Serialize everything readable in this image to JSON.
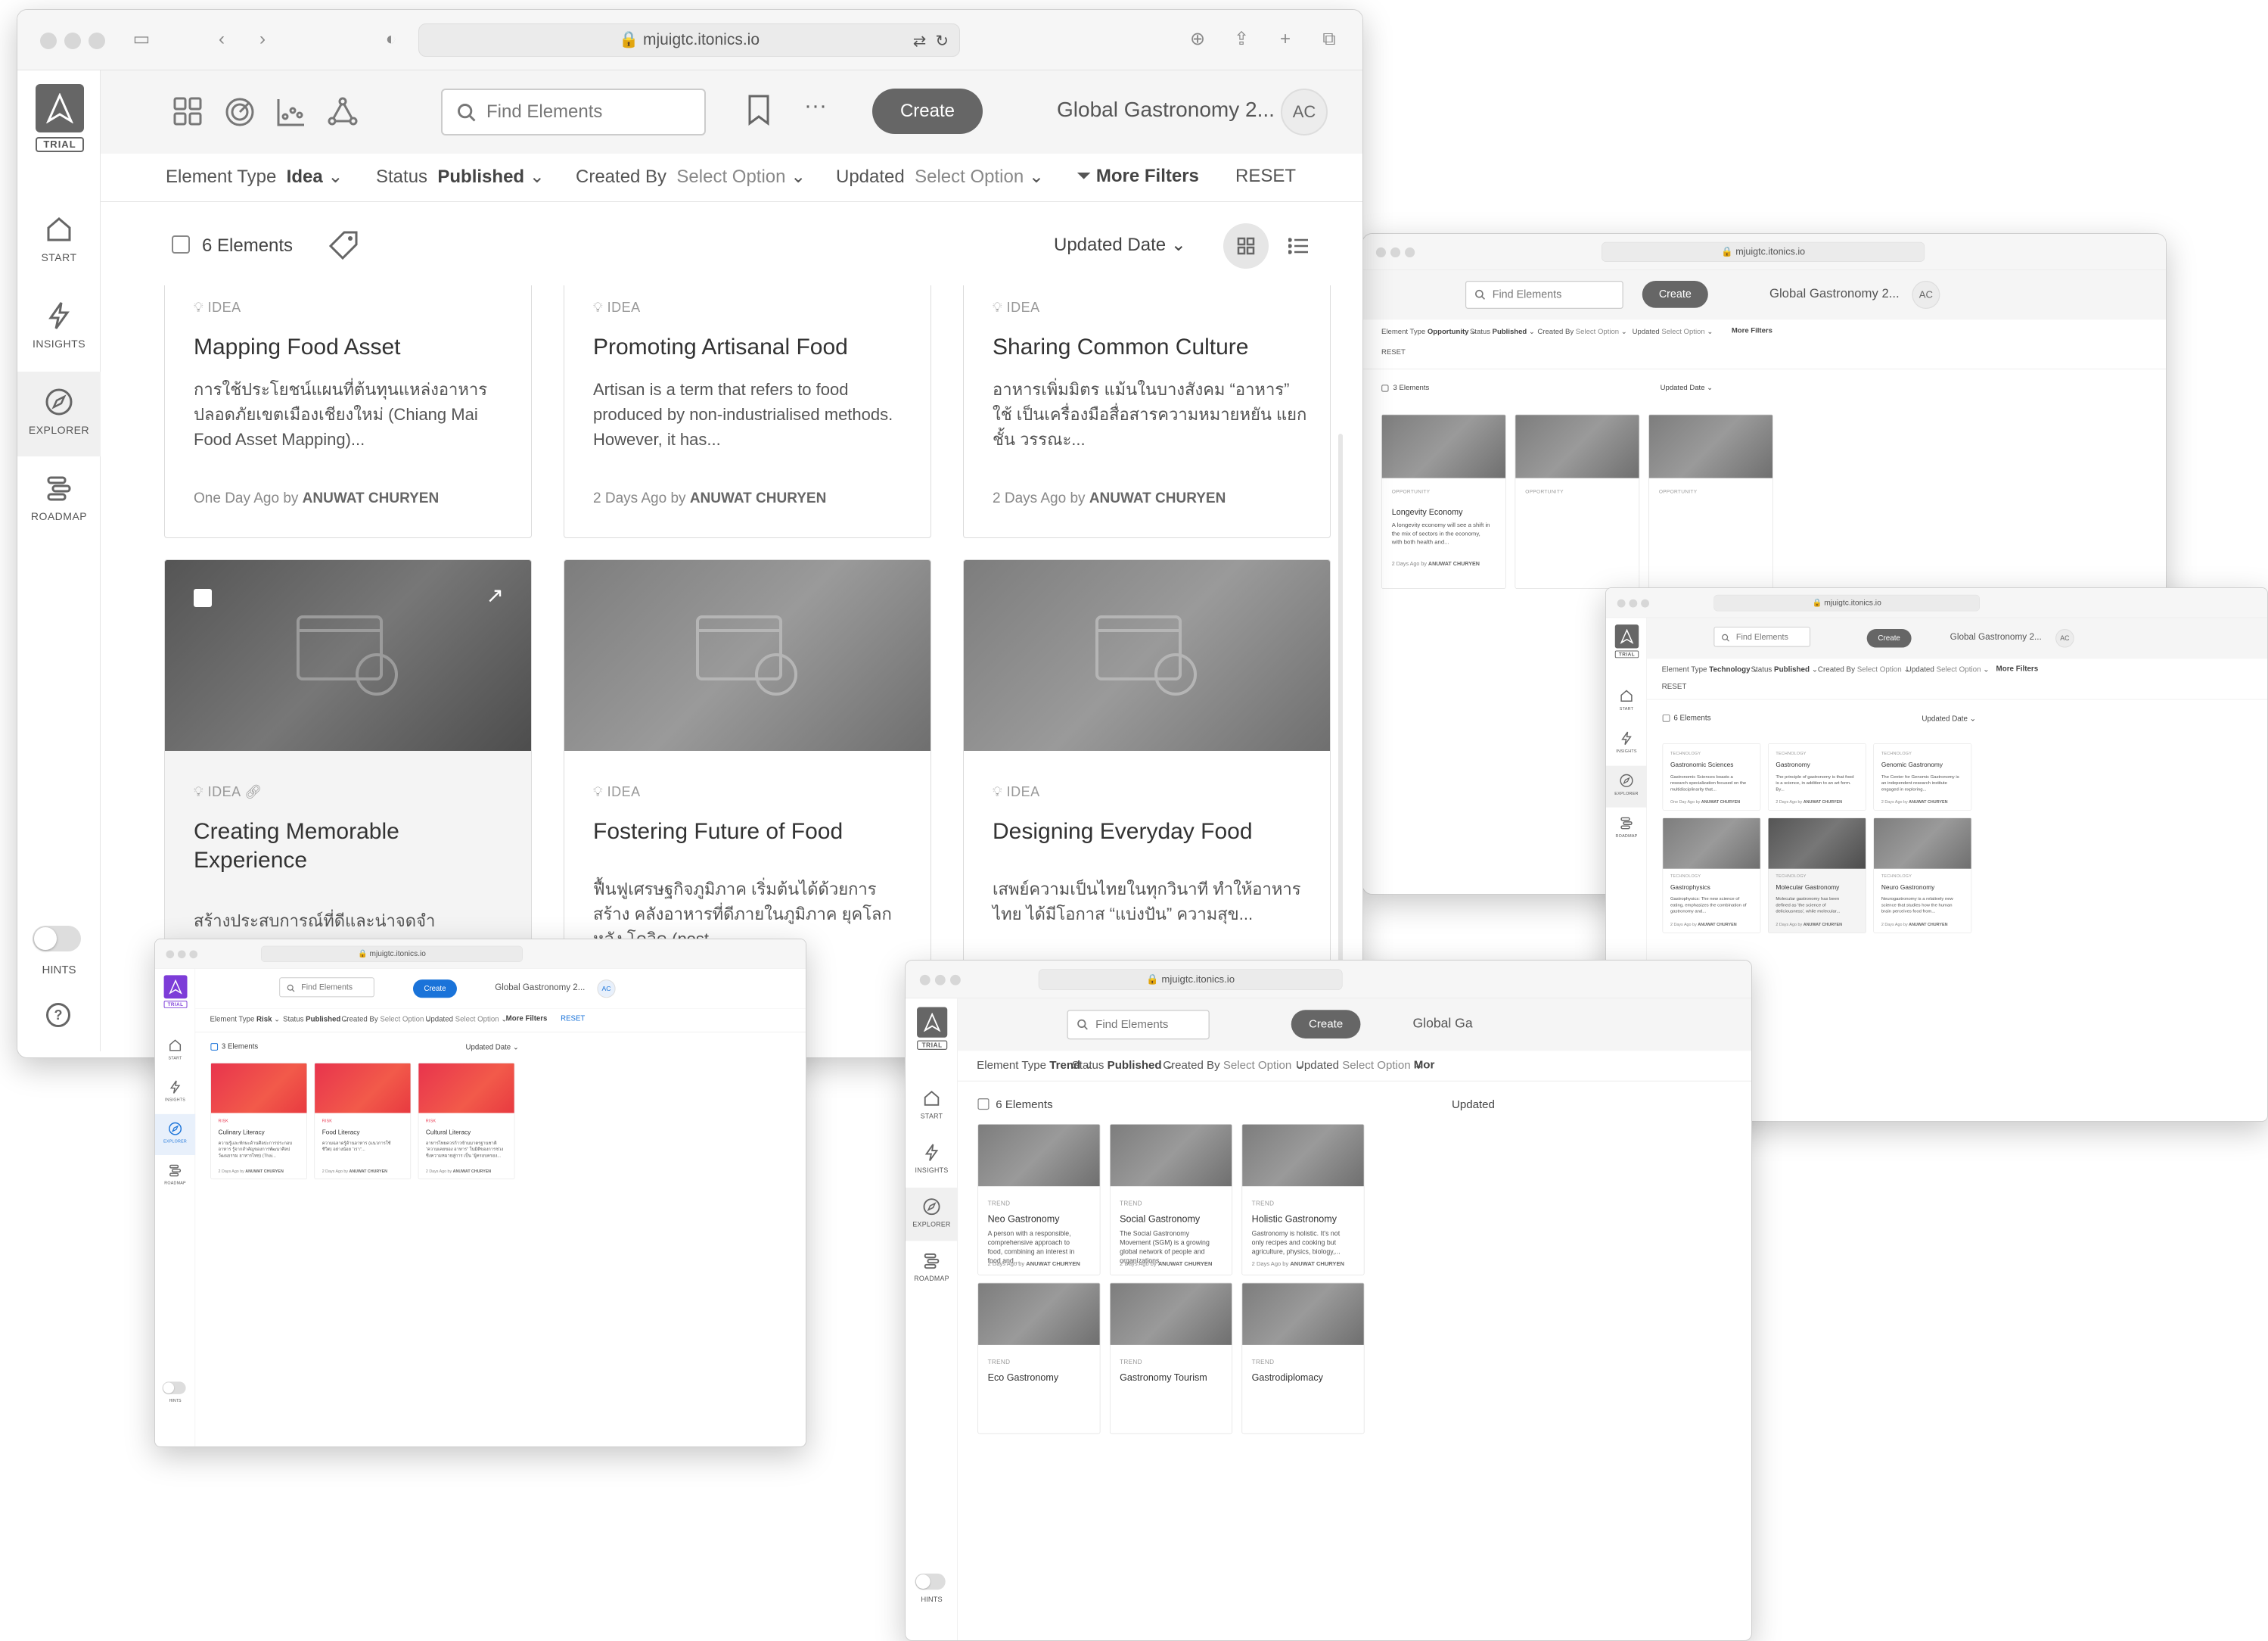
{
  "windows": {
    "main": {
      "url": "mjuigtc.itonics.io",
      "workspace": "Global Gastronomy 2...",
      "avatar": "AC",
      "search_placeholder": "Find Elements",
      "create_label": "Create",
      "trial_label": "TRIAL",
      "nav": [
        {
          "label": "START",
          "icon": "home-icon"
        },
        {
          "label": "INSIGHTS",
          "icon": "bolt-icon"
        },
        {
          "label": "EXPLORER",
          "icon": "compass-icon"
        },
        {
          "label": "ROADMAP",
          "icon": "roadmap-icon"
        }
      ],
      "hints_label": "HINTS",
      "help_label": "?",
      "filters": {
        "element_type_label": "Element Type",
        "element_type_value": "Idea",
        "status_label": "Status",
        "status_value": "Published",
        "created_by_label": "Created By",
        "created_by_value": "Select Option",
        "updated_label": "Updated",
        "updated_value": "Select Option",
        "more_filters": "More Filters",
        "reset": "RESET"
      },
      "count_label": "6 Elements",
      "sort_label": "Updated Date",
      "cards": [
        {
          "type": "IDEA",
          "title": "Mapping Food Asset",
          "desc": "การใช้ประโยชน์แผนที่ต้นทุนแหล่งอาหาร ปลอดภัยเขตเมืองเชียงใหม่ (Chiang Mai Food Asset Mapping)...",
          "time": "One Day Ago",
          "by": "by",
          "author": "ANUWAT CHURYEN"
        },
        {
          "type": "IDEA",
          "title": "Promoting Artisanal Food",
          "desc": "Artisan is a term that refers to food produced by non-industrialised methods. However, it has...",
          "time": "2 Days Ago",
          "by": "by",
          "author": "ANUWAT CHURYEN"
        },
        {
          "type": "IDEA",
          "title": "Sharing Common Culture",
          "desc": "อาหารเพิ่มมิตร แม้นในบางสังคม “อาหาร” ใช้ เป็นเครื่องมือสื่อสารความหมายหยัน แยกชั้น วรรณะ...",
          "time": "2 Days Ago",
          "by": "by",
          "author": "ANUWAT CHURYEN"
        },
        {
          "type": "IDEA",
          "title": "Creating Memorable Experience",
          "desc": "สร้างประสบการณ์ที่ดีและน่าจดจำ",
          "time": "",
          "by": "",
          "author": ""
        },
        {
          "type": "IDEA",
          "title": "Fostering Future of Food",
          "desc": "ฟื้นฟูเศรษฐกิจภูมิภาค เริ่มต้นได้ด้วยการสร้าง คลังอาหารที่ดีภายในภูมิภาค ยุคโลกหลัง โควิด (post...",
          "time": "",
          "by": "",
          "author": ""
        },
        {
          "type": "IDEA",
          "title": "Designing Everyday Food",
          "desc": "เสพย์ความเป็นไทยในทุกวินาที ทำให้อาหาร ไทย ได้มีโอกาส “แบ่งปัน” ความสุข...",
          "time": "",
          "by": "",
          "author": ""
        }
      ]
    },
    "opportunity": {
      "url": "mjuigtc.itonics.io",
      "workspace": "Global Gastronomy 2...",
      "avatar": "AC",
      "search_placeholder": "Find Elements",
      "create_label": "Create",
      "filters": {
        "element_type_label": "Element Type",
        "element_type_value": "Opportunity",
        "status_label": "Status",
        "status_value": "Published",
        "created_by_label": "Created By",
        "created_by_value": "Select Option",
        "updated_label": "Updated",
        "updated_value": "Select Option",
        "more_filters": "More Filters",
        "reset": "RESET"
      },
      "count_label": "3 Elements",
      "sort_label": "Updated Date",
      "cards": [
        {
          "type": "OPPORTUNITY",
          "title": "Longevity Economy",
          "desc": "A longevity economy will see a shift in the mix of sectors in the economy, with both health and...",
          "time": "2 Days Ago",
          "by": "by",
          "author": "ANUWAT CHURYEN"
        },
        {
          "type": "OPPORTUNITY",
          "title": "",
          "desc": "",
          "time": "",
          "by": "",
          "author": ""
        },
        {
          "type": "OPPORTUNITY",
          "title": "",
          "desc": "",
          "time": "",
          "by": "",
          "author": ""
        }
      ]
    },
    "technology": {
      "url": "mjuigtc.itonics.io",
      "workspace": "Global Gastronomy 2...",
      "avatar": "AC",
      "search_placeholder": "Find Elements",
      "create_label": "Create",
      "trial_label": "TRIAL",
      "nav": [
        {
          "label": "START"
        },
        {
          "label": "INSIGHTS"
        },
        {
          "label": "EXPLORER"
        },
        {
          "label": "ROADMAP"
        }
      ],
      "hints_label": "HINTS",
      "filters": {
        "element_type_label": "Element Type",
        "element_type_value": "Technology",
        "status_label": "Status",
        "status_value": "Published",
        "created_by_label": "Created By",
        "created_by_value": "Select Option",
        "updated_label": "Updated",
        "updated_value": "Select Option",
        "more_filters": "More Filters",
        "reset": "RESET"
      },
      "count_label": "6 Elements",
      "sort_label": "Updated Date",
      "cards": [
        {
          "type": "TECHNOLOGY",
          "title": "Gastronomic Sciences",
          "desc": "Gastronomic Sciences boasts a research specialization focused on the multidisciplinarity that...",
          "time": "One Day Ago",
          "by": "by",
          "author": "ANUWAT CHURYEN"
        },
        {
          "type": "TECHNOLOGY",
          "title": "Gastronomy",
          "desc": "The principle of gastronomy is that food is a science, in addition to an art form. By...",
          "time": "2 Days Ago",
          "by": "by",
          "author": "ANUWAT CHURYEN"
        },
        {
          "type": "TECHNOLOGY",
          "title": "Genomic Gastronomy",
          "desc": "The Center for Genomic Gastronomy is an independent research institute engaged in exploring...",
          "time": "2 Days Ago",
          "by": "by",
          "author": "ANUWAT CHURYEN"
        },
        {
          "type": "TECHNOLOGY",
          "title": "Gastrophysics",
          "desc": "Gastrophysics: The new science of eating, emphasizes the combination of gastronomy and...",
          "time": "2 Days Ago",
          "by": "by",
          "author": "ANUWAT CHURYEN"
        },
        {
          "type": "TECHNOLOGY",
          "title": "Molecular Gastronomy",
          "desc": "Molecular gastronomy has been defined as 'the science of deliciousness', while molecular...",
          "time": "2 Days Ago",
          "by": "by",
          "author": "ANUWAT CHURYEN"
        },
        {
          "type": "TECHNOLOGY",
          "title": "Neuro Gastronomy",
          "desc": "Neurogastronomy is a relatively new science that studies how the human brain perceives food from...",
          "time": "2 Days Ago",
          "by": "by",
          "author": "ANUWAT CHURYEN"
        }
      ]
    },
    "risk": {
      "url": "mjuigtc.itonics.io",
      "workspace": "Global Gastronomy 2...",
      "avatar": "AC",
      "search_placeholder": "Find Elements",
      "create_label": "Create",
      "trial_label": "TRIAL",
      "nav": [
        {
          "label": "START"
        },
        {
          "label": "INSIGHTS"
        },
        {
          "label": "EXPLORER"
        },
        {
          "label": "ROADMAP"
        }
      ],
      "hints_label": "HINTS",
      "filters": {
        "element_type_label": "Element Type",
        "element_type_value": "Risk",
        "status_label": "Status",
        "status_value": "Published",
        "created_by_label": "Created By",
        "created_by_value": "Select Option",
        "updated_label": "Updated",
        "updated_value": "Select Option",
        "more_filters": "More Filters",
        "reset": "RESET"
      },
      "count_label": "3 Elements",
      "sort_label": "Updated Date",
      "accent": "#1a73d9",
      "risk_color": "#e8344d",
      "cards": [
        {
          "type": "RISK",
          "title": "Culinary Literacy",
          "desc": "ความรู้และทักษะด้านศิลปะการประกอบอาหาร รู้จากสำคัญของการพัฒนาศิลปวัฒนธรรม อาหารไทย) (Thai...",
          "time": "2 Days Ago",
          "by": "by",
          "author": "ANUWAT CHURYEN"
        },
        {
          "type": "RISK",
          "title": "Food Literacy",
          "desc": "ความฉลาดรู้ด้านอาหาร (แนวการใช้ชีวิต) อย่างน้อย “เรา”...",
          "time": "2 Days Ago",
          "by": "by",
          "author": "ANUWAT CHURYEN"
        },
        {
          "type": "RISK",
          "title": "Cultural Literacy",
          "desc": "อาหารไทยควรก้าวข้ามมาตรฐานชาติ “ความเคยของ อาหาร” ในมิติของการช่วงชิงความหมายสู่การ เป็น “ผู้ครอบครอง...",
          "time": "2 Days Ago",
          "by": "by",
          "author": "ANUWAT CHURYEN"
        }
      ]
    },
    "trend": {
      "url": "mjuigtc.itonics.io",
      "workspace": "Global Ga",
      "search_placeholder": "Find Elements",
      "create_label": "Create",
      "trial_label": "TRIAL",
      "nav": [
        {
          "label": "START"
        },
        {
          "label": "INSIGHTS"
        },
        {
          "label": "EXPLORER"
        },
        {
          "label": "ROADMAP"
        }
      ],
      "hints_label": "HINTS",
      "filters": {
        "element_type_label": "Element Type",
        "element_type_value": "Trend",
        "status_label": "Status",
        "status_value": "Published",
        "created_by_label": "Created By",
        "created_by_value": "Select Option",
        "updated_label": "Updated",
        "updated_value": "Select Option",
        "more_filters": "Mor"
      },
      "count_label": "6 Elements",
      "sort_label": "Updated",
      "cards": [
        {
          "type": "TREND",
          "title": "Neo Gastronomy",
          "desc": "A person with a responsible, comprehensive approach to food, combining an interest in food and...",
          "time": "2 Days Ago",
          "by": "by",
          "author": "ANUWAT CHURYEN"
        },
        {
          "type": "TREND",
          "title": "Social Gastronomy",
          "desc": "The Social Gastronomy Movement (SGM) is a growing global network of people and organizations...",
          "time": "2 Days Ago",
          "by": "by",
          "author": "ANUWAT CHURYEN"
        },
        {
          "type": "TREND",
          "title": "Holistic Gastronomy",
          "desc": "Gastronomy is holistic. It's not only recipes and cooking but agriculture, physics, biology,...",
          "time": "2 Days Ago",
          "by": "by",
          "author": "ANUWAT CHURYEN"
        },
        {
          "type": "TREND",
          "title": "Eco Gastronomy",
          "desc": "",
          "time": "",
          "by": "",
          "author": ""
        },
        {
          "type": "TREND",
          "title": "Gastronomy Tourism",
          "desc": "",
          "time": "",
          "by": "",
          "author": ""
        },
        {
          "type": "TREND",
          "title": "Gastrodiplomacy",
          "desc": "",
          "time": "",
          "by": "",
          "author": ""
        }
      ]
    }
  }
}
